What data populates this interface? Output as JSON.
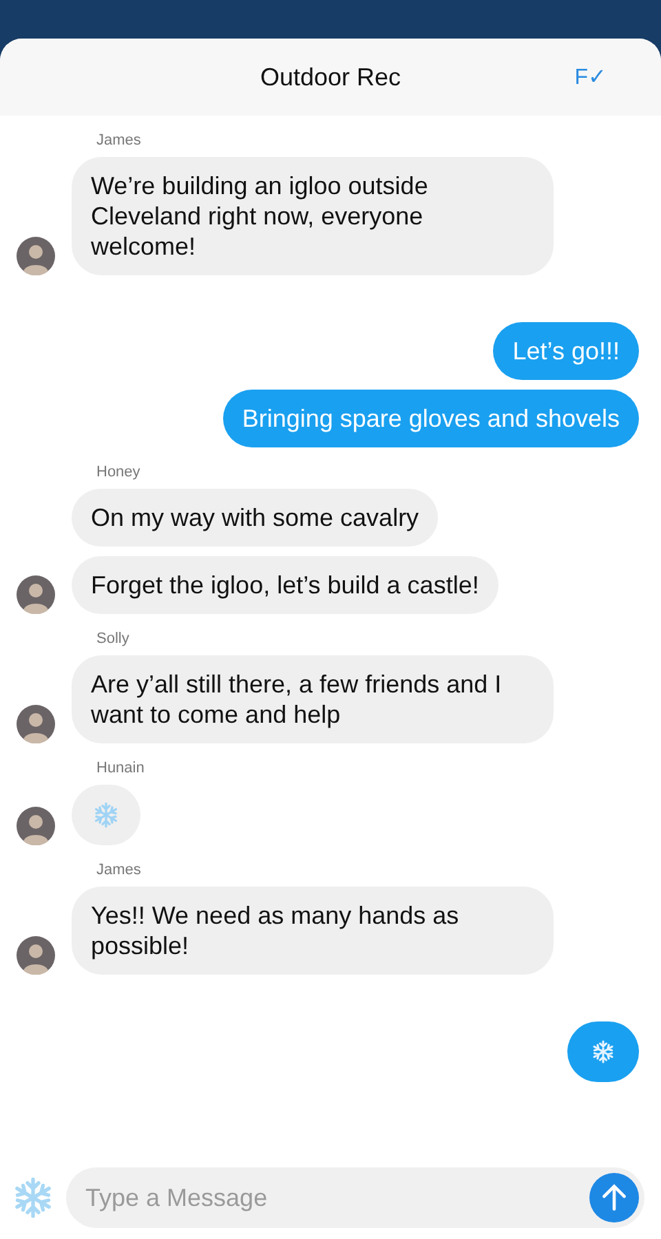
{
  "header": {
    "title": "Outdoor Rec",
    "action": "F✓"
  },
  "groups": [
    {
      "kind": "incoming",
      "sender": "James",
      "messages": [
        {
          "kind": "text",
          "text": "We’re building an igloo outside Cleveland right now, everyone welcome!"
        }
      ]
    },
    {
      "kind": "outgoing",
      "messages": [
        {
          "kind": "text",
          "text": "Let’s go!!!"
        },
        {
          "kind": "text",
          "text": "Bringing spare gloves and shovels"
        }
      ]
    },
    {
      "kind": "incoming",
      "sender": "Honey",
      "messages": [
        {
          "kind": "text",
          "text": "On my way with some cavalry"
        },
        {
          "kind": "text",
          "text": "Forget the igloo, let’s build a castle!"
        }
      ]
    },
    {
      "kind": "incoming",
      "sender": "Solly",
      "messages": [
        {
          "kind": "text",
          "text": "Are y’all still there, a few friends and I want to come and help"
        }
      ]
    },
    {
      "kind": "incoming",
      "sender": "Hunain",
      "messages": [
        {
          "kind": "snowflake"
        }
      ]
    },
    {
      "kind": "incoming",
      "sender": "James",
      "messages": [
        {
          "kind": "text",
          "text": "Yes!! We need as many hands as possible!"
        }
      ]
    },
    {
      "kind": "outgoing",
      "messages": [
        {
          "kind": "snowflake"
        }
      ]
    }
  ],
  "composer": {
    "placeholder": "Type a Message"
  }
}
